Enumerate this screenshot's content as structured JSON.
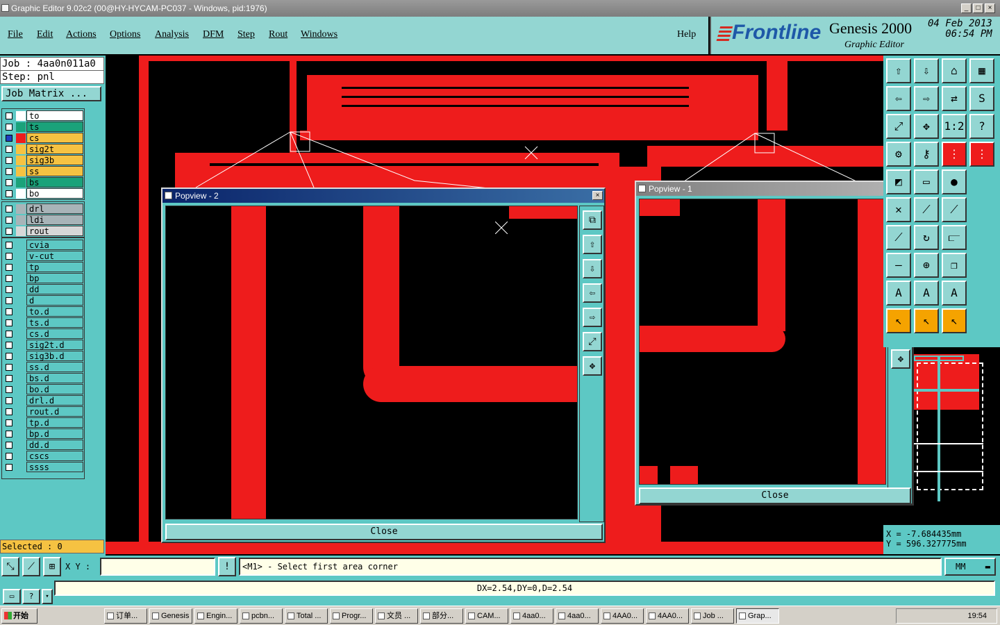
{
  "window": {
    "title": "Graphic Editor 9.02c2 (00@HY-HYCAM-PC037 - Windows, pid:1976)",
    "min": "_",
    "max": "□",
    "close": "×"
  },
  "menu": {
    "items": [
      "File",
      "Edit",
      "Actions",
      "Options",
      "Analysis",
      "DFM",
      "Step",
      "Rout",
      "Windows"
    ],
    "help": "Help"
  },
  "logo": {
    "brand": "Frontline",
    "product": "Genesis 2000",
    "subtitle": "Graphic Editor",
    "date": "04 Feb 2013",
    "time": "06:54 PM"
  },
  "job": {
    "job_line": "Job : 4aa0n011a0",
    "step_line": "Step: pnl",
    "matrix_button": "Job Matrix ..."
  },
  "layers": {
    "group1": [
      {
        "name": "to",
        "color": "#ffffff",
        "swatch": "#ffffff"
      },
      {
        "name": "ts",
        "color": "#1aa27a",
        "swatch": "#1aa27a"
      },
      {
        "name": "cs",
        "color": "#f5c242",
        "swatch": "#ee1c1c",
        "active": true
      },
      {
        "name": "sig2t",
        "color": "#f5c242",
        "swatch": "#f5c242"
      },
      {
        "name": "sig3b",
        "color": "#f5c242",
        "swatch": "#f5c242"
      },
      {
        "name": "ss",
        "color": "#f5c242",
        "swatch": "#f5c242"
      },
      {
        "name": "bs",
        "color": "#1aa27a",
        "swatch": "#1aa27a"
      },
      {
        "name": "bo",
        "color": "#ffffff",
        "swatch": "#ffffff"
      }
    ],
    "group2": [
      {
        "name": "drl",
        "color": "#a8b4b8",
        "swatch": "#a8b4b8"
      },
      {
        "name": "ldi",
        "color": "#a8b4b8",
        "swatch": "#a8b4b8"
      },
      {
        "name": "rout",
        "color": "#d8d8d8",
        "swatch": "#d8d8d8"
      }
    ],
    "group3": [
      {
        "name": "cvia"
      },
      {
        "name": "v-cut"
      },
      {
        "name": "tp"
      },
      {
        "name": "bp"
      },
      {
        "name": "dd"
      },
      {
        "name": "d"
      },
      {
        "name": "to.d"
      },
      {
        "name": "ts.d"
      },
      {
        "name": "cs.d"
      },
      {
        "name": "sig2t.d"
      },
      {
        "name": "sig3b.d"
      },
      {
        "name": "ss.d"
      },
      {
        "name": "bs.d"
      },
      {
        "name": "bo.d"
      },
      {
        "name": "drl.d"
      },
      {
        "name": "rout.d"
      },
      {
        "name": "tp.d"
      },
      {
        "name": "bp.d"
      },
      {
        "name": "dd.d"
      },
      {
        "name": "cscs"
      },
      {
        "name": "ssss"
      }
    ],
    "default_color": "#5dc8c4"
  },
  "selected": "Selected : 0",
  "popview2": {
    "title": "Popview - 2",
    "close_label": "Close"
  },
  "popview1": {
    "title": "Popview - 1",
    "close_label": "Close"
  },
  "coords": {
    "x": "X  =  -7.684435mm",
    "y": "Y  =  596.327775mm"
  },
  "status": {
    "xy_label": "X Y :",
    "xy_value": "",
    "prompt": "<M1> - Select first area corner",
    "unit": "MM",
    "unit_arrow": "▬"
  },
  "measure": "DX=2.54,DY=0,D=2.54",
  "taskbar": {
    "start": "开始",
    "tasks": [
      "订单...",
      "Genesis",
      "Engin...",
      "pcbn...",
      "Total ...",
      "Progr...",
      "文员 ...",
      "部分...",
      "CAM...",
      "4aa0...",
      "4aa0...",
      "4AA0...",
      "4AA0...",
      "Job ...",
      "Grap..."
    ],
    "clock": "19:54"
  },
  "colors": {
    "copper": "#ee1c1c",
    "panel": "#5dc8c4",
    "panel_light": "#93d6d2",
    "active_layer": "#f5c242"
  }
}
